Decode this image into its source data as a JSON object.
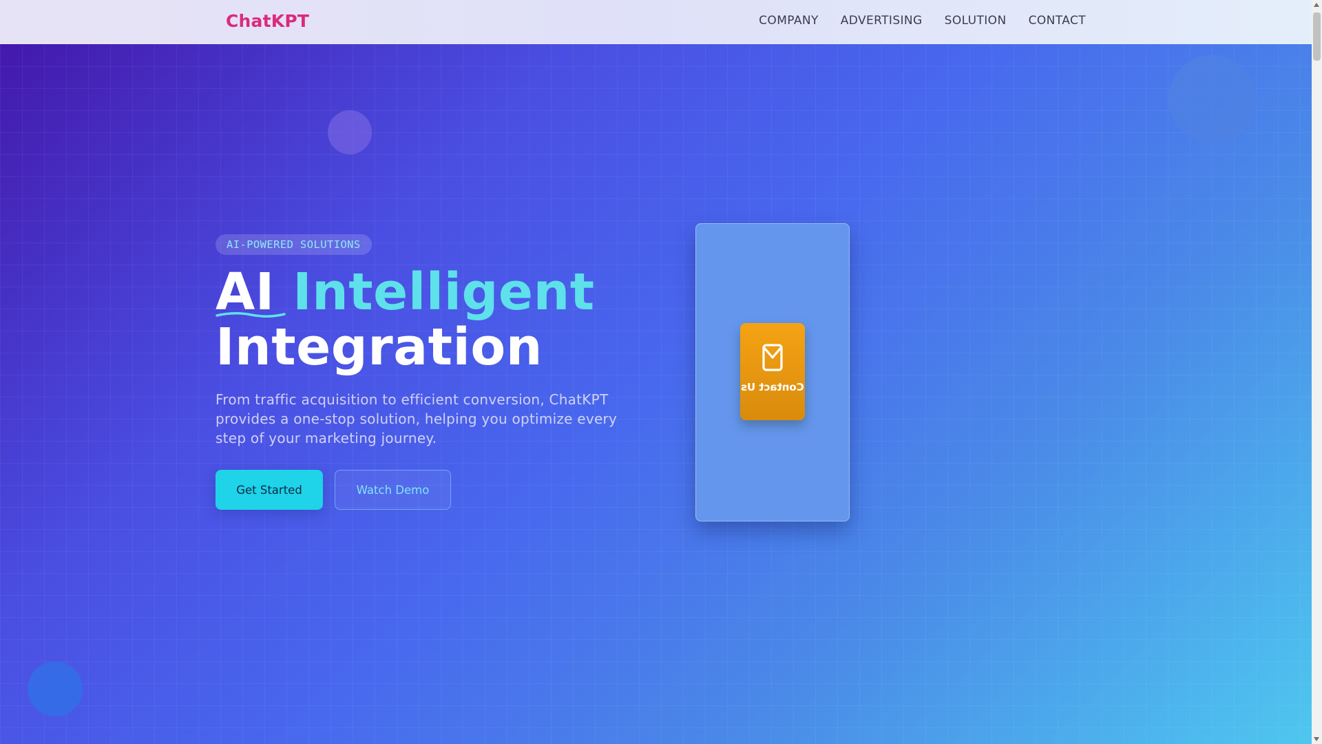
{
  "brand": "ChatKPT",
  "nav": {
    "items": [
      {
        "label": "COMPANY"
      },
      {
        "label": "ADVERTISING"
      },
      {
        "label": "SOLUTION"
      },
      {
        "label": "CONTACT"
      }
    ]
  },
  "hero": {
    "badge": "AI-POWERED SOLUTIONS",
    "title_part1": "AI",
    "title_part2": "Intelligent",
    "title_part3": "Integration",
    "description": "From traffic acquisition to efficient conversion, ChatKPT provides a one-stop solution, helping you optimize every step of your marketing journey.",
    "primary_button": "Get Started",
    "secondary_button": "Watch Demo"
  },
  "phone": {
    "contact_label": "Contact Us",
    "contact_icon": "mail-icon"
  },
  "colors": {
    "brand": "#db2a7d",
    "accent": "#5ee1ea",
    "primary_button": "#1fd3e8",
    "contact_card": "#f5a314"
  }
}
